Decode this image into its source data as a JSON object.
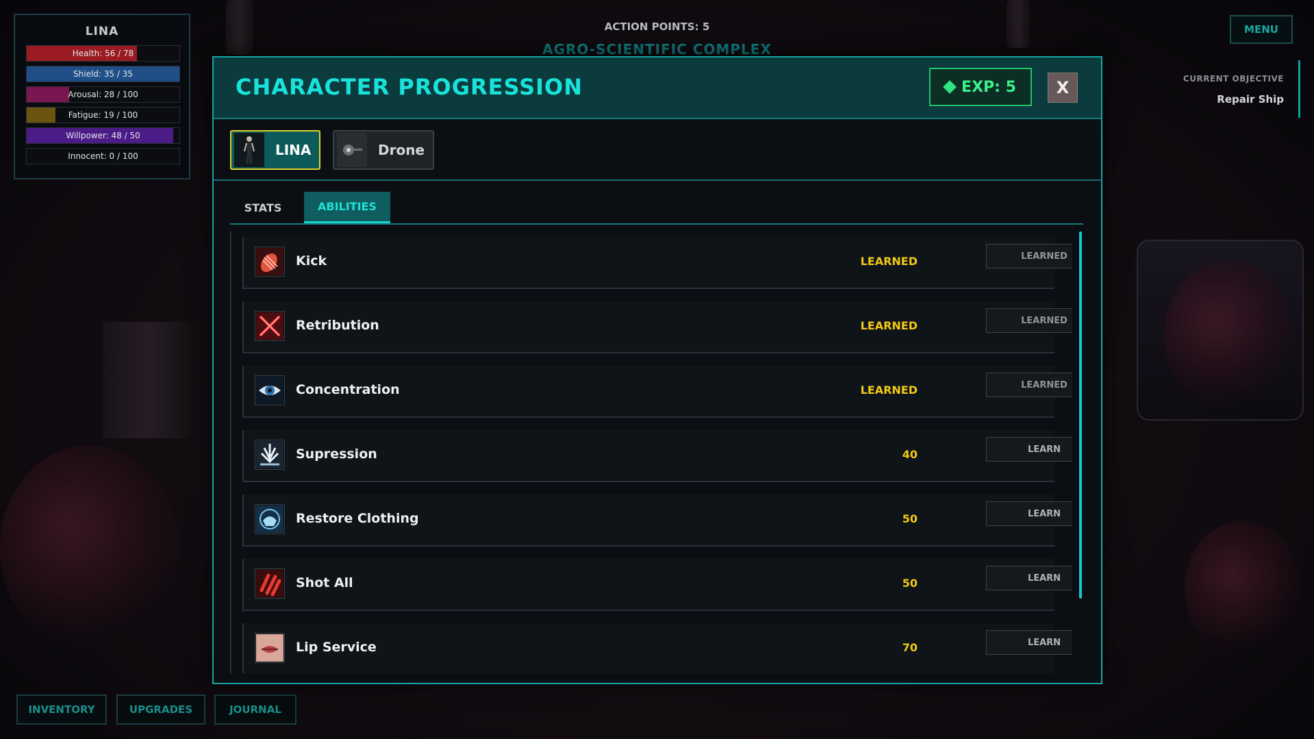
{
  "hud": {
    "character_name": "LINA",
    "bars": [
      {
        "label": "Health: 56 / 78",
        "fill": 0.72,
        "color": "#9a1c22"
      },
      {
        "label": "Shield: 35 / 35",
        "fill": 1.0,
        "color": "#1f4f86"
      },
      {
        "label": "Arousal: 28 / 100",
        "fill": 0.28,
        "color": "#7a1650"
      },
      {
        "label": "Fatigue: 19 / 100",
        "fill": 0.19,
        "color": "#6b5410"
      },
      {
        "label": "Willpower: 48 / 50",
        "fill": 0.96,
        "color": "#4b1b87"
      },
      {
        "label": "Innocent: 0 / 100",
        "fill": 0.0,
        "color": "#3a3f44"
      }
    ],
    "action_points": "ACTION POINTS: 5",
    "location": "AGRO-SCIENTIFIC COMPLEX",
    "menu_label": "MENU",
    "objective_label": "CURRENT OBJECTIVE",
    "objective_value": "Repair Ship",
    "bottom_buttons": [
      "INVENTORY",
      "UPGRADES",
      "JOURNAL"
    ]
  },
  "modal": {
    "title": "CHARACTER PROGRESSION",
    "exp_label": "EXP: 5",
    "close_label": "X",
    "characters": [
      {
        "name": "LINA",
        "active": true
      },
      {
        "name": "Drone",
        "active": false
      }
    ],
    "tabs": [
      {
        "label": "STATS",
        "active": false
      },
      {
        "label": "ABILITIES",
        "active": true
      }
    ],
    "abilities": [
      {
        "name": "Kick",
        "cost": "LEARNED",
        "button": "LEARNED",
        "icon": "kick-icon",
        "learned": true
      },
      {
        "name": "Retribution",
        "cost": "LEARNED",
        "button": "LEARNED",
        "icon": "crossed-swords-icon",
        "learned": true
      },
      {
        "name": "Concentration",
        "cost": "LEARNED",
        "button": "LEARNED",
        "icon": "eye-icon",
        "learned": true
      },
      {
        "name": "Supression",
        "cost": "40",
        "button": "LEARN",
        "icon": "suppression-arrows-icon",
        "learned": false
      },
      {
        "name": "Restore Clothing",
        "cost": "50",
        "button": "LEARN",
        "icon": "restore-clothing-icon",
        "learned": false
      },
      {
        "name": "Shot All",
        "cost": "50",
        "button": "LEARN",
        "icon": "bullets-icon",
        "learned": false
      },
      {
        "name": "Lip Service",
        "cost": "70",
        "button": "LEARN",
        "icon": "lips-icon",
        "learned": false
      }
    ]
  }
}
